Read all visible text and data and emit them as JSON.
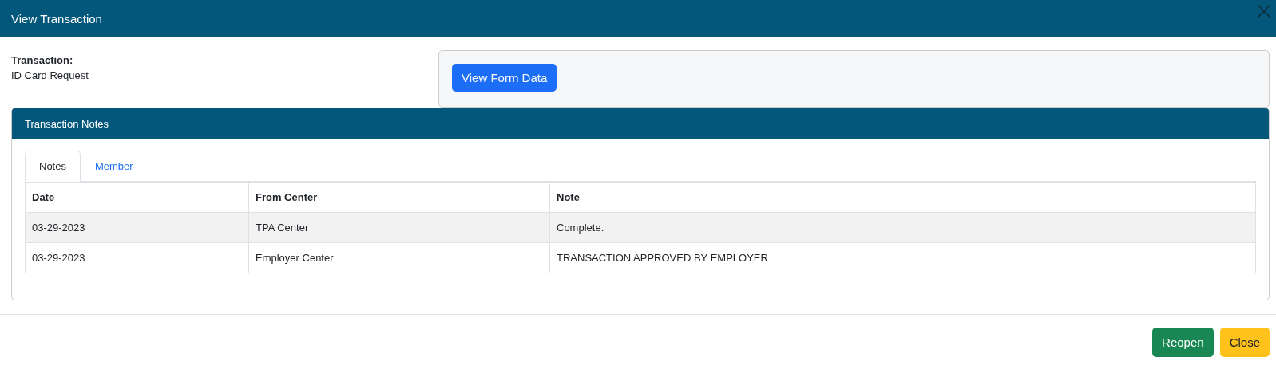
{
  "window": {
    "title": "View Transaction"
  },
  "transaction": {
    "label": "Transaction:",
    "value": "ID Card Request"
  },
  "form_button": "View Form Data",
  "notes_card": {
    "title": "Transaction Notes",
    "tabs": [
      {
        "label": "Notes",
        "selected": true
      },
      {
        "label": "Member",
        "selected": false
      }
    ],
    "table": {
      "columns": [
        "Date",
        "From Center",
        "Note"
      ],
      "rows": [
        [
          "03-29-2023",
          "TPA Center",
          "Complete."
        ],
        [
          "03-29-2023",
          "Employer Center",
          "TRANSACTION APPROVED BY EMPLOYER"
        ]
      ]
    }
  },
  "buttons": [
    {
      "label": "Reopen",
      "kind": "success"
    },
    {
      "label": "Close",
      "kind": "warning"
    }
  ]
}
